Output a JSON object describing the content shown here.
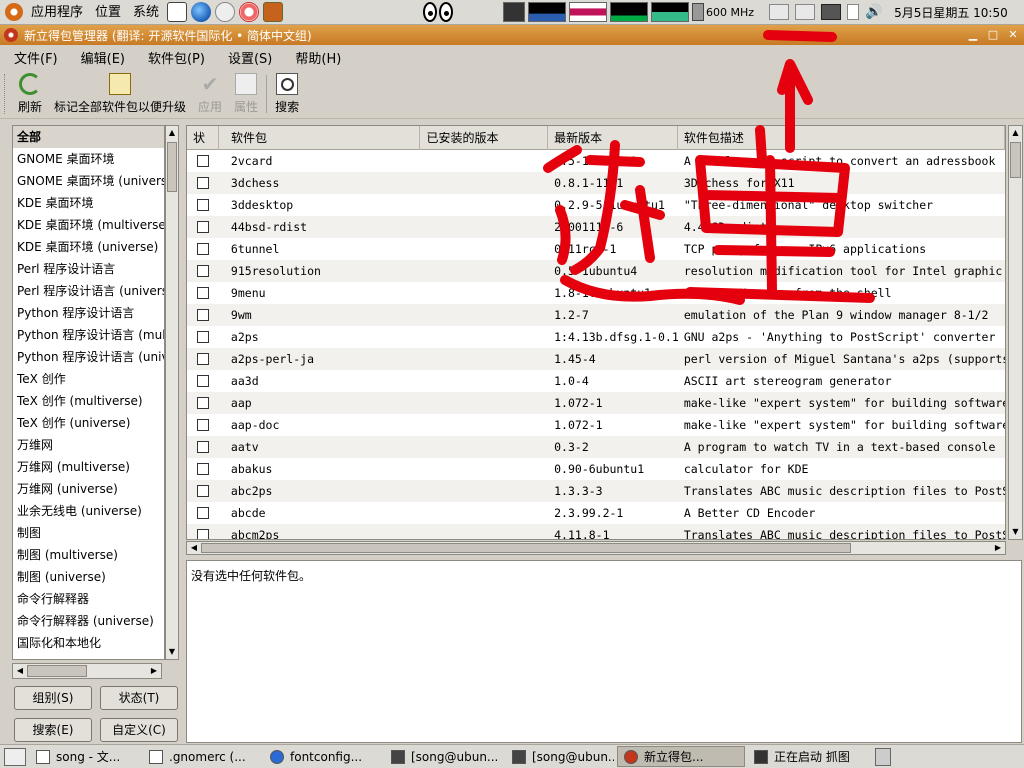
{
  "top_panel": {
    "menus": [
      "应用程序",
      "位置",
      "系统"
    ],
    "cpu_freq": "600 MHz",
    "clock": "5月5日星期五  10:50"
  },
  "window": {
    "title": "新立得包管理器 (翻译: 开源软件国际化 • 简体中文组)"
  },
  "menubar": [
    "文件(F)",
    "编辑(E)",
    "软件包(P)",
    "设置(S)",
    "帮助(H)"
  ],
  "toolbar": {
    "refresh": "刷新",
    "mark_upgrades": "标记全部软件包以便升级",
    "apply": "应用",
    "properties": "属性",
    "search": "搜索"
  },
  "categories": [
    "全部",
    "GNOME 桌面环境",
    "GNOME 桌面环境 (universe)",
    "KDE 桌面环境",
    "KDE 桌面环境 (multiverse)",
    "KDE 桌面环境 (universe)",
    "Perl 程序设计语言",
    "Perl 程序设计语言 (universe)",
    "Python 程序设计语言",
    "Python 程序设计语言 (multiverse)",
    "Python 程序设计语言 (universe)",
    "TeX 创作",
    "TeX 创作 (multiverse)",
    "TeX 创作 (universe)",
    "万维网",
    "万维网 (multiverse)",
    "万维网 (universe)",
    "业余无线电 (universe)",
    "制图",
    "制图 (multiverse)",
    "制图 (universe)",
    "命令行解释器",
    "命令行解释器 (universe)",
    "国际化和本地化"
  ],
  "left_buttons": {
    "sections": "组别(S)",
    "status": "状态(T)",
    "search": "搜索(E)",
    "custom": "自定义(C)"
  },
  "table": {
    "columns": [
      "状",
      "软件包",
      "已安装的版本",
      "最新版本",
      "软件包描述"
    ],
    "rows": [
      {
        "name": "2vcard",
        "installed": "",
        "latest": "0.5-1ubuntu1",
        "desc": "A little perl script to convert an adressbook"
      },
      {
        "name": "3dchess",
        "installed": "",
        "latest": "0.8.1-11.1",
        "desc": "3D chess for X11"
      },
      {
        "name": "3ddesktop",
        "installed": "",
        "latest": "0.2.9-5.1ubuntu1",
        "desc": "\"Three-dimensional\" desktop switcher"
      },
      {
        "name": "44bsd-rdist",
        "installed": "",
        "latest": "20001111-6",
        "desc": "4.4BSD rdist."
      },
      {
        "name": "6tunnel",
        "installed": "",
        "latest": "0.11rc1-1",
        "desc": "TCP proxy for non-IPv6 applications"
      },
      {
        "name": "915resolution",
        "installed": "",
        "latest": "0.5-1ubuntu4",
        "desc": "resolution modification tool for Intel graphic chips"
      },
      {
        "name": "9menu",
        "installed": "",
        "latest": "1.8-1.1ubuntu1",
        "desc": "Creates X menus from the shell"
      },
      {
        "name": "9wm",
        "installed": "",
        "latest": "1.2-7",
        "desc": "emulation of the Plan 9 window manager 8-1/2"
      },
      {
        "name": "a2ps",
        "installed": "",
        "latest": "1:4.13b.dfsg.1-0.1",
        "desc": "GNU a2ps - 'Anything to PostScript' converter"
      },
      {
        "name": "a2ps-perl-ja",
        "installed": "",
        "latest": "1.45-4",
        "desc": "perl version of Miguel Santana's a2ps (supports"
      },
      {
        "name": "aa3d",
        "installed": "",
        "latest": "1.0-4",
        "desc": "ASCII art stereogram generator"
      },
      {
        "name": "aap",
        "installed": "",
        "latest": "1.072-1",
        "desc": "make-like \"expert system\" for building software"
      },
      {
        "name": "aap-doc",
        "installed": "",
        "latest": "1.072-1",
        "desc": "make-like \"expert system\" for building software"
      },
      {
        "name": "aatv",
        "installed": "",
        "latest": "0.3-2",
        "desc": "A program to watch TV in a text-based console"
      },
      {
        "name": "abakus",
        "installed": "",
        "latest": "0.90-6ubuntu1",
        "desc": "calculator for KDE"
      },
      {
        "name": "abc2ps",
        "installed": "",
        "latest": "1.3.3-3",
        "desc": "Translates ABC music description files to PostScript"
      },
      {
        "name": "abcde",
        "installed": "",
        "latest": "2.3.99.2-1",
        "desc": "A Better CD Encoder"
      },
      {
        "name": "abcm2ps",
        "installed": "",
        "latest": "4.11.8-1",
        "desc": "Translates ABC music description files to PostScript"
      }
    ]
  },
  "details_text": "没有选中任何软件包。",
  "taskbar": [
    {
      "icon": "text-editor-icon",
      "label": "song - 文..."
    },
    {
      "icon": "text-editor-icon",
      "label": ".gnomerc (..."
    },
    {
      "icon": "browser-icon",
      "label": "fontconfig..."
    },
    {
      "icon": "terminal-icon",
      "label": "[song@ubun..."
    },
    {
      "icon": "terminal-icon",
      "label": "[song@ubun..."
    },
    {
      "icon": "package-icon",
      "label": "新立得包..."
    },
    {
      "icon": "camera-icon",
      "label": "正在启动 抓图"
    }
  ],
  "annotation_text": "这里",
  "colors": {
    "title_bar": "#c77a23",
    "annotation": "#e4000d"
  }
}
